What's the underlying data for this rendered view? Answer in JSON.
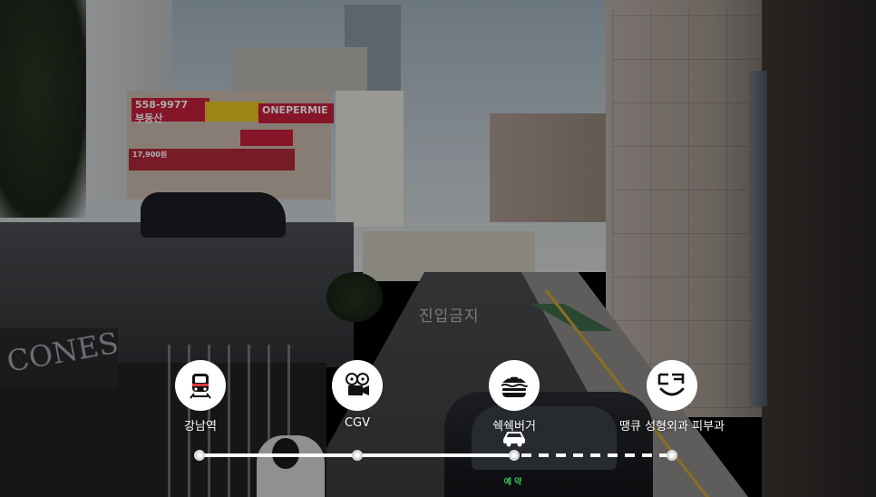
{
  "scene": {
    "description_alt": ""
  },
  "street": {
    "signs": {
      "phone_sign": "558-9977",
      "realty_sign": "부동산",
      "banner_one": "ONEPERMIE",
      "road_marking": "진입금지",
      "building_sign": "CONES",
      "price_sign": "17,900원"
    }
  },
  "route": {
    "stops": [
      {
        "name": "강남역",
        "icon": "train-icon"
      },
      {
        "name": "CGV",
        "icon": "film-projector-icon"
      },
      {
        "name": "쉑쉑버거",
        "icon": "burger-icon"
      },
      {
        "name": "땡큐 성형외과 피부과",
        "icon": "smile-logo-icon"
      }
    ],
    "current_index": 2,
    "current_marker_icon": "car-icon",
    "current_status": "예약",
    "colors": {
      "track": "#ffffff",
      "dot_border": "#d9d9d9",
      "status": "#39c45c"
    }
  }
}
